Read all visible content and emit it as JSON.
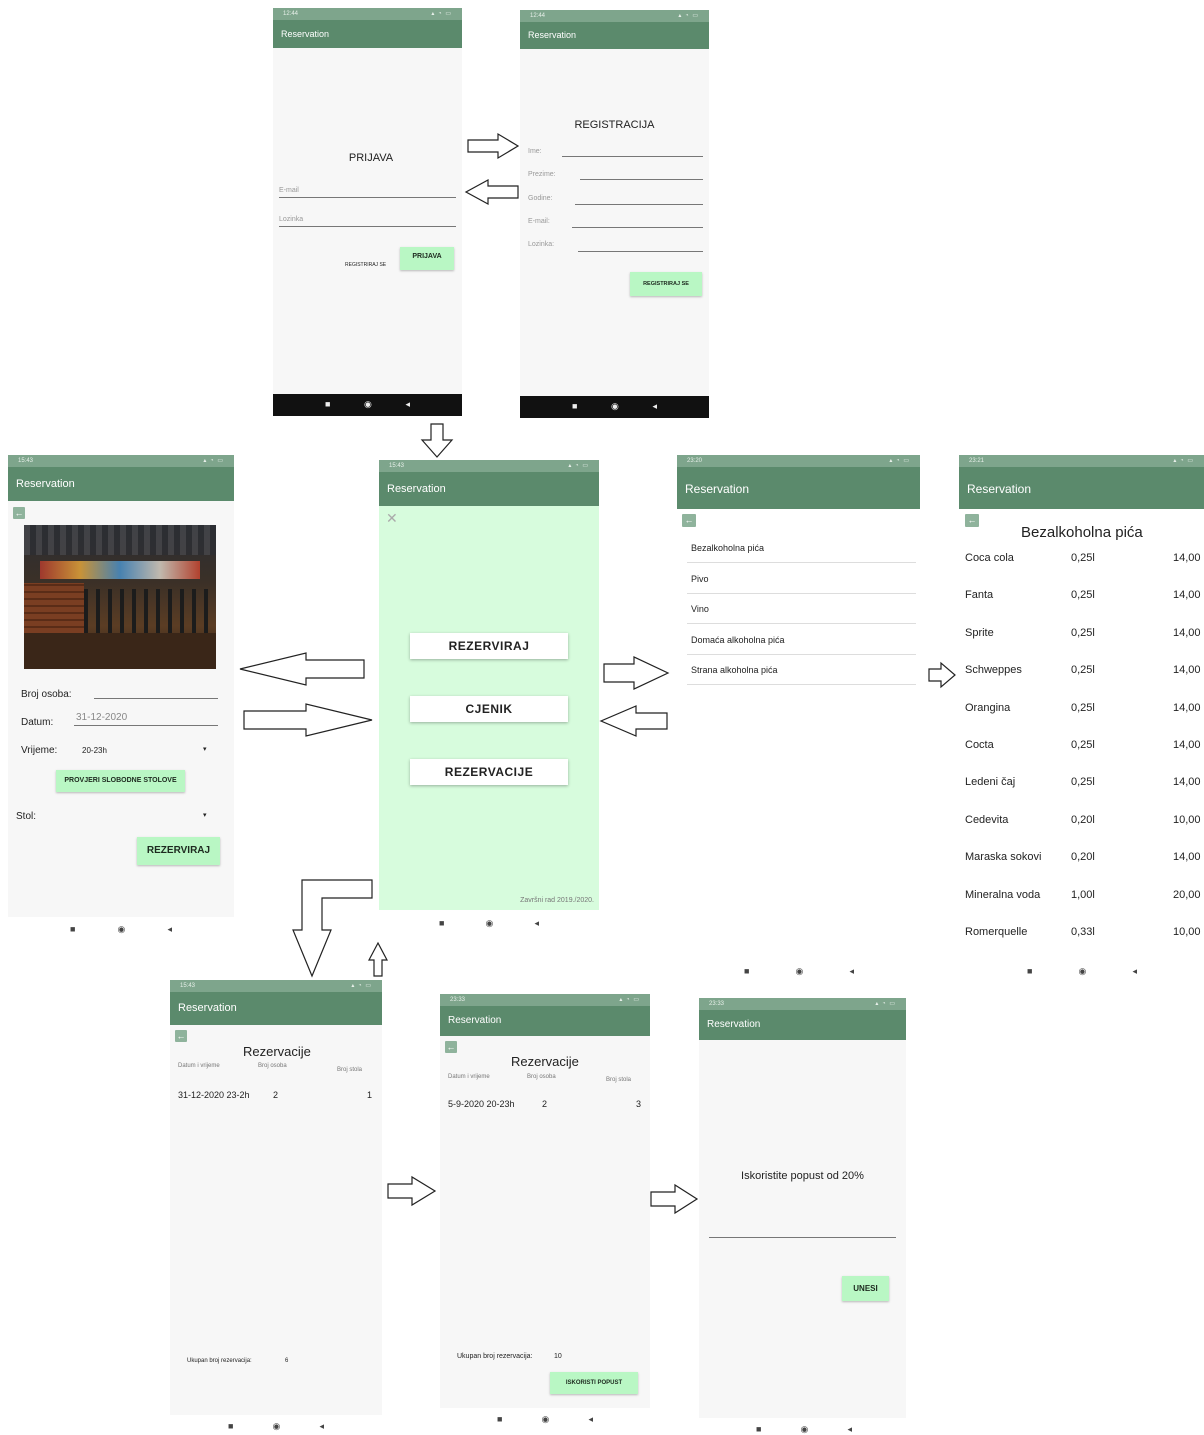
{
  "common": {
    "app_title": "Reservation",
    "nav_icons": [
      "square-icon",
      "circle-icon",
      "triangle-back-icon"
    ],
    "back_icon": "arrow-left-icon",
    "close_icon": "close-icon",
    "colors": {
      "appbar": "#5b8a6c",
      "statusbar": "#7ea58c",
      "button_green": "#b9f7c4",
      "menu_bg": "#d7fcdd"
    }
  },
  "login": {
    "status_time": "12:44",
    "title": "PRIJAVA",
    "email_placeholder": "E-mail",
    "password_placeholder": "Lozinka",
    "register_link": "REGISTRIRAJ SE",
    "login_button": "PRIJAVA"
  },
  "register": {
    "status_time": "12:44",
    "title": "REGISTRACIJA",
    "fields": [
      "Ime:",
      "Prezime:",
      "Godine:",
      "E-mail:",
      "Lozinka:"
    ],
    "button": "REGISTRIRAJ SE"
  },
  "booking": {
    "status_time": "15:43",
    "persons_label": "Broj osoba:",
    "date_label": "Datum:",
    "date_value": "31-12-2020",
    "time_label": "Vrijeme:",
    "time_value": "20-23h",
    "check_button": "PROVJERI SLOBODNE STOLOVE",
    "table_label": "Stol:",
    "reserve_button": "REZERVIRAJ"
  },
  "menu": {
    "status_time": "15:43",
    "buttons": [
      "REZERVIRAJ",
      "CJENIK",
      "REZERVACIJE"
    ],
    "footer": "Završni rad 2019./2020."
  },
  "categories": {
    "status_time": "23:20",
    "items": [
      "Bezalkoholna pića",
      "Pivo",
      "Vino",
      "Domaća alkoholna pića",
      "Strana alkoholna pića"
    ]
  },
  "prices": {
    "status_time": "23:21",
    "heading": "Bezalkoholna pića",
    "rows": [
      {
        "name": "Coca cola",
        "volume": "0,25l",
        "price": "14,00"
      },
      {
        "name": "Fanta",
        "volume": "0,25l",
        "price": "14,00"
      },
      {
        "name": "Sprite",
        "volume": "0,25l",
        "price": "14,00"
      },
      {
        "name": "Schweppes",
        "volume": "0,25l",
        "price": "14,00"
      },
      {
        "name": "Orangina",
        "volume": "0,25l",
        "price": "14,00"
      },
      {
        "name": "Cocta",
        "volume": "0,25l",
        "price": "14,00"
      },
      {
        "name": "Ledeni čaj",
        "volume": "0,25l",
        "price": "14,00"
      },
      {
        "name": "Cedevita",
        "volume": "0,20l",
        "price": "10,00"
      },
      {
        "name": "Maraska sokovi",
        "volume": "0,20l",
        "price": "14,00"
      },
      {
        "name": "Mineralna voda",
        "volume": "1,00l",
        "price": "20,00"
      },
      {
        "name": "Romerquelle",
        "volume": "0,33l",
        "price": "10,00"
      }
    ]
  },
  "reservations1": {
    "status_time": "15:43",
    "heading": "Rezervacije",
    "col_datetime": "Datum i vrijeme",
    "col_persons": "Broj osoba",
    "col_table": "Broj stola",
    "row": {
      "datetime": "31-12-2020 23-2h",
      "persons": "2",
      "table": "1"
    },
    "total_label": "Ukupan broj rezervacija:",
    "total_value": "6"
  },
  "reservations2": {
    "status_time": "23:33",
    "heading": "Rezervacije",
    "col_datetime": "Datum i vrijeme",
    "col_persons": "Broj osoba",
    "col_table": "Broj stola",
    "row": {
      "datetime": "5-9-2020 20-23h",
      "persons": "2",
      "table": "3"
    },
    "total_label": "Ukupan broj rezervacija:",
    "total_value": "10",
    "discount_button": "ISKORISTI POPUST"
  },
  "discount": {
    "status_time": "23:33",
    "message": "Iskoristite popust od 20%",
    "button": "UNESI"
  }
}
